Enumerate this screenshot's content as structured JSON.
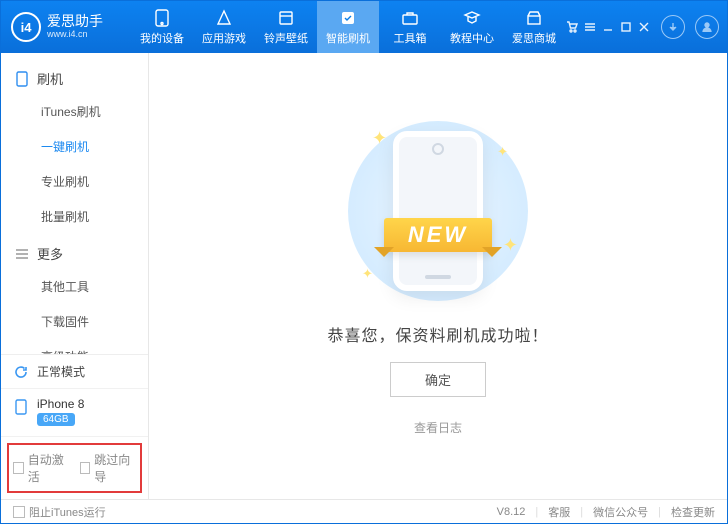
{
  "brand": {
    "logoText": "i4",
    "name": "爱思助手",
    "url": "www.i4.cn"
  },
  "nav": {
    "items": [
      {
        "id": "device",
        "label": "我的设备"
      },
      {
        "id": "apps",
        "label": "应用游戏"
      },
      {
        "id": "ring",
        "label": "铃声壁纸"
      },
      {
        "id": "flash",
        "label": "智能刷机"
      },
      {
        "id": "toolbox",
        "label": "工具箱"
      },
      {
        "id": "tutorial",
        "label": "教程中心"
      },
      {
        "id": "mall",
        "label": "爱思商城"
      }
    ],
    "activeId": "flash"
  },
  "sidebar": {
    "sections": [
      {
        "title": "刷机",
        "iconColor": "#2f8ef0",
        "items": [
          "iTunes刷机",
          "一键刷机",
          "专业刷机",
          "批量刷机"
        ],
        "activeIndex": 1
      },
      {
        "title": "更多",
        "iconColor": "#888",
        "items": [
          "其他工具",
          "下载固件",
          "高级功能"
        ],
        "activeIndex": -1
      }
    ],
    "mode": {
      "label": "正常模式"
    },
    "device": {
      "name": "iPhone 8",
      "storage": "64GB"
    },
    "options": {
      "autoActivate": "自动激活",
      "skipWizard": "跳过向导"
    }
  },
  "main": {
    "ribbon": "NEW",
    "message": "恭喜您，保资料刷机成功啦！",
    "okButton": "确定",
    "viewLog": "查看日志"
  },
  "statusbar": {
    "blockItunes": "阻止iTunes运行",
    "version": "V8.12",
    "links": [
      "客服",
      "微信公众号",
      "检查更新"
    ]
  }
}
